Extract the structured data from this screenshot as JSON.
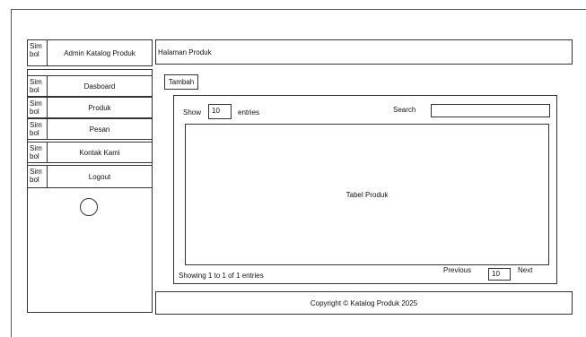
{
  "sidebar": {
    "header": {
      "icon_text": "Sim bol",
      "title": "Admin Katalog Produk"
    },
    "items": [
      {
        "icon_text": "Sim bol",
        "label": "Dasboard"
      },
      {
        "icon_text": "Sim bol",
        "label": "Produk"
      },
      {
        "icon_text": "Sim bol",
        "label": "Pesan"
      },
      {
        "icon_text": "Sim bol",
        "label": "Kontak Kami"
      },
      {
        "icon_text": "Sim bol",
        "label": "Logout"
      }
    ]
  },
  "header": {
    "title": "Halaman Produk"
  },
  "main": {
    "add_button": "Tambah",
    "show_label": "Show",
    "entries_value": "10",
    "entries_label": "entries",
    "search_label": "Search",
    "search_value": "",
    "table_label": "Tabel Produk",
    "info": "Showing 1 to 1 of 1 entries",
    "previous": "Previous",
    "page_value": "10",
    "next": "Next"
  },
  "footer": {
    "text": "Copyright © Katalog Produk 2025"
  }
}
